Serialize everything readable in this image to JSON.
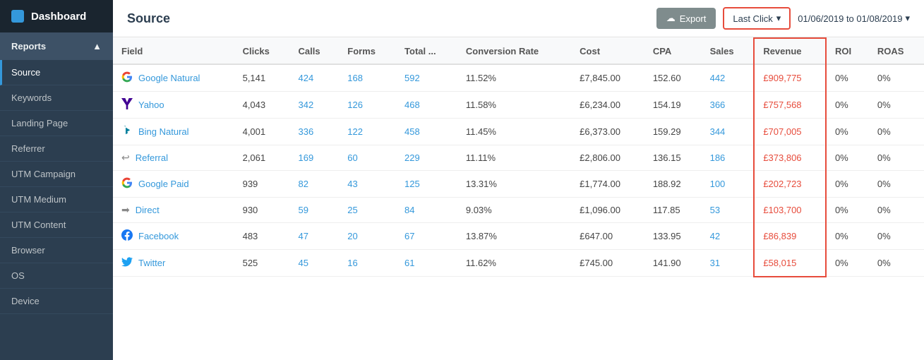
{
  "sidebar": {
    "header": {
      "title": "Dashboard",
      "icon": "dashboard-icon"
    },
    "sections": [
      {
        "label": "Reports",
        "icon": "↑",
        "expanded": true
      }
    ],
    "items": [
      {
        "label": "Source",
        "active": true
      },
      {
        "label": "Keywords",
        "active": false
      },
      {
        "label": "Landing Page",
        "active": false
      },
      {
        "label": "Referrer",
        "active": false
      },
      {
        "label": "UTM Campaign",
        "active": false
      },
      {
        "label": "UTM Medium",
        "active": false
      },
      {
        "label": "UTM Content",
        "active": false
      },
      {
        "label": "Browser",
        "active": false
      },
      {
        "label": "OS",
        "active": false
      },
      {
        "label": "Device",
        "active": false
      }
    ]
  },
  "topbar": {
    "title": "Source",
    "export_label": "Export",
    "last_click_label": "Last Click",
    "date_range": "01/06/2019 to 01/08/2019"
  },
  "table": {
    "columns": [
      "Field",
      "Clicks",
      "Calls",
      "Forms",
      "Total ...",
      "Conversion Rate",
      "Cost",
      "CPA",
      "Sales",
      "Revenue",
      "ROI",
      "ROAS"
    ],
    "rows": [
      {
        "source": "Google Natural",
        "icon": "G",
        "icon_color": "#4285F4",
        "clicks": "5,141",
        "calls": "424",
        "forms": "168",
        "total": "592",
        "conversion_rate": "11.52%",
        "cost": "£7,845.00",
        "cpa": "152.60",
        "sales": "442",
        "revenue": "£909,775",
        "roi": "0%",
        "roas": "0%"
      },
      {
        "source": "Yahoo",
        "icon": "Y",
        "icon_color": "#410093",
        "clicks": "4,043",
        "calls": "342",
        "forms": "126",
        "total": "468",
        "conversion_rate": "11.58%",
        "cost": "£6,234.00",
        "cpa": "154.19",
        "sales": "366",
        "revenue": "£757,568",
        "roi": "0%",
        "roas": "0%"
      },
      {
        "source": "Bing Natural",
        "icon": "B",
        "icon_color": "#00809d",
        "clicks": "4,001",
        "calls": "336",
        "forms": "122",
        "total": "458",
        "conversion_rate": "11.45%",
        "cost": "£6,373.00",
        "cpa": "159.29",
        "sales": "344",
        "revenue": "£707,005",
        "roi": "0%",
        "roas": "0%"
      },
      {
        "source": "Referral",
        "icon": "↩",
        "icon_color": "#888",
        "clicks": "2,061",
        "calls": "169",
        "forms": "60",
        "total": "229",
        "conversion_rate": "11.11%",
        "cost": "£2,806.00",
        "cpa": "136.15",
        "sales": "186",
        "revenue": "£373,806",
        "roi": "0%",
        "roas": "0%"
      },
      {
        "source": "Google Paid",
        "icon": "G",
        "icon_color": "#4285F4",
        "clicks": "939",
        "calls": "82",
        "forms": "43",
        "total": "125",
        "conversion_rate": "13.31%",
        "cost": "£1,774.00",
        "cpa": "188.92",
        "sales": "100",
        "revenue": "£202,723",
        "roi": "0%",
        "roas": "0%"
      },
      {
        "source": "Direct",
        "icon": "→",
        "icon_color": "#888",
        "clicks": "930",
        "calls": "59",
        "forms": "25",
        "total": "84",
        "conversion_rate": "9.03%",
        "cost": "£1,096.00",
        "cpa": "117.85",
        "sales": "53",
        "revenue": "£103,700",
        "roi": "0%",
        "roas": "0%"
      },
      {
        "source": "Facebook",
        "icon": "f",
        "icon_color": "#1877F2",
        "clicks": "483",
        "calls": "47",
        "forms": "20",
        "total": "67",
        "conversion_rate": "13.87%",
        "cost": "£647.00",
        "cpa": "133.95",
        "sales": "42",
        "revenue": "£86,839",
        "roi": "0%",
        "roas": "0%"
      },
      {
        "source": "Twitter",
        "icon": "t",
        "icon_color": "#1DA1F2",
        "clicks": "525",
        "calls": "45",
        "forms": "16",
        "total": "61",
        "conversion_rate": "11.62%",
        "cost": "£745.00",
        "cpa": "141.90",
        "sales": "31",
        "revenue": "£58,015",
        "roi": "0%",
        "roas": "0%"
      }
    ]
  },
  "icons": {
    "search": "🔍",
    "cloud_upload": "☁",
    "chevron_down": "▾",
    "chevron_up": "▲",
    "calendar": "📅",
    "arrow_right": "→",
    "arrow_return": "↩",
    "twitter_t": "🐦",
    "facebook_f": "f",
    "google_g": "G",
    "yahoo_y": "Y",
    "bing_b": "b"
  }
}
